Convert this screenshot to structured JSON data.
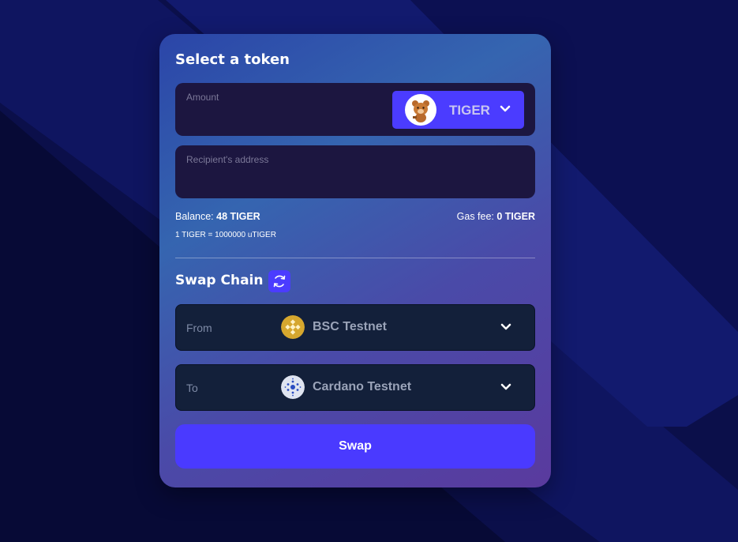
{
  "card": {
    "title": "Select a token"
  },
  "amount": {
    "label": "Amount",
    "value": ""
  },
  "token": {
    "name": "TIGER",
    "icon": "tiger-avatar-icon"
  },
  "recipient": {
    "label": "Recipient's address",
    "value": ""
  },
  "balance": {
    "label": "Balance:",
    "value": "48 TIGER"
  },
  "gas": {
    "label": "Gas fee:",
    "value": "0 TIGER"
  },
  "rate": {
    "text": "1 TIGER = 1000000 uTIGER"
  },
  "swap_chain": {
    "title": "Swap Chain",
    "icon": "swap-arrows-icon"
  },
  "from": {
    "label": "From",
    "chain": "BSC Testnet",
    "icon": "bnb-icon"
  },
  "to": {
    "label": "To",
    "chain": "Cardano Testnet",
    "icon": "cardano-icon"
  },
  "swap_button": {
    "label": "Swap"
  },
  "colors": {
    "accent": "#4b3cff",
    "field_bg": "#1c1640",
    "chain_bg": "#13203a",
    "page_bg": "#0a0d45"
  }
}
